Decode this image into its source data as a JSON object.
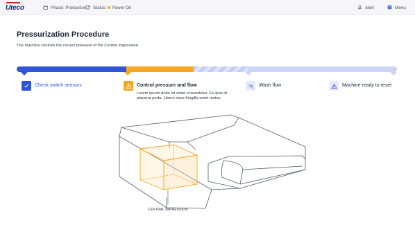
{
  "brand": {
    "logo_text": "Uteco",
    "accent": "#d7262b",
    "navy": "#1d2a7a"
  },
  "topbar": {
    "phase_icon": "factory-icon",
    "phase": "Phase: Production",
    "status_icon": "gauge-icon",
    "status_prefix": "Status:",
    "status_value": "Power On",
    "status_color": "#f5a623",
    "alert_icon": "bell-icon",
    "alert_label": "Alert",
    "menu_icon": "menu-icon",
    "menu_label": "Menu"
  },
  "page": {
    "title": "Pressurization Procedure",
    "subtitle": "The machine controls the correct pressure of the Central Impression."
  },
  "progress": {
    "colors": {
      "done": "#2f54d6",
      "active": "#f5a623",
      "pending": "#cbd5f5"
    },
    "segments": [
      "done",
      "active",
      "pending",
      "pending"
    ]
  },
  "steps": [
    {
      "label": "Check switch sensors",
      "state": "done",
      "icon": "check-icon"
    },
    {
      "label": "Control pressure and flow",
      "state": "active",
      "icon": "warning-icon",
      "description": "Lorem ipsum dolor sit amet consectetur. Eu quis id placerat porta. Libero risus fringilla amet metus."
    },
    {
      "label": "Wash flow",
      "state": "pending",
      "icon": "wash-icon"
    },
    {
      "label": "Machine ready to reset",
      "state": "pending",
      "icon": "reset-icon"
    }
  ],
  "illustration": {
    "callout": "CENTRAL IMPRESSION"
  }
}
